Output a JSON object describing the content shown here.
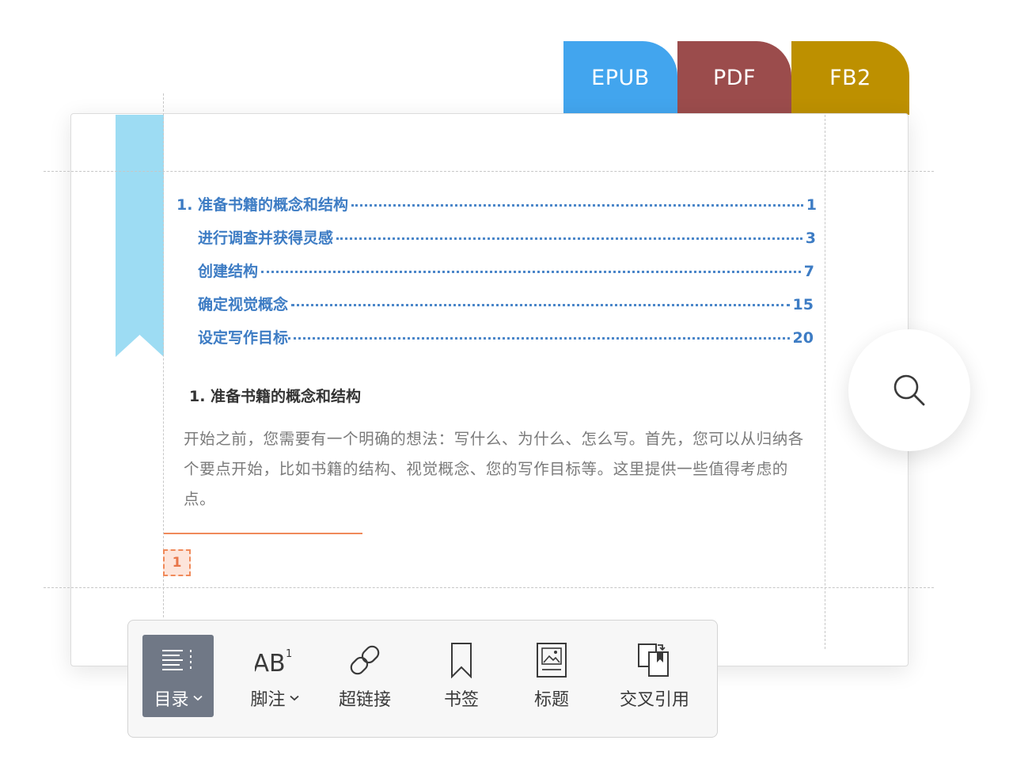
{
  "tabs": [
    {
      "label": "EPUB",
      "color": "#42a5ee"
    },
    {
      "label": "PDF",
      "color": "#9b4c4c"
    },
    {
      "label": "FB2",
      "color": "#bd9000"
    }
  ],
  "toc": [
    {
      "title": "1. 准备书籍的概念和结构",
      "page": "1"
    },
    {
      "title": "进行调查并获得灵感",
      "page": "3"
    },
    {
      "title": "创建结构",
      "page": "7"
    },
    {
      "title": "确定视觉概念",
      "page": "15"
    },
    {
      "title": "设定写作目标",
      "page": "20"
    }
  ],
  "heading": "1. 准备书籍的概念和结构",
  "paragraph": "开始之前，您需要有一个明确的想法：写什么、为什么、怎么写。首先，您可以从归纳各个要点开始，比如书籍的结构、视觉概念、您的写作目标等。这里提供一些值得考虑的点。",
  "footnote_marker": "1",
  "toolbar": {
    "items": [
      {
        "label": "目录",
        "icon": "toc-icon",
        "dropdown": true,
        "active": true
      },
      {
        "label": "脚注",
        "icon": "footnote-icon",
        "dropdown": true,
        "active": false
      },
      {
        "label": "超链接",
        "icon": "hyperlink-icon",
        "dropdown": false,
        "active": false
      },
      {
        "label": "书签",
        "icon": "bookmark-icon",
        "dropdown": false,
        "active": false
      },
      {
        "label": "标题",
        "icon": "caption-icon",
        "dropdown": false,
        "active": false
      },
      {
        "label": "交叉引用",
        "icon": "cross-reference-icon",
        "dropdown": false,
        "active": false
      }
    ]
  },
  "colors": {
    "toc_link": "#3d7cc4",
    "ribbon": "#9ddcf3",
    "footnote_accent": "#f08a5a",
    "toolbar_active": "#707886"
  }
}
